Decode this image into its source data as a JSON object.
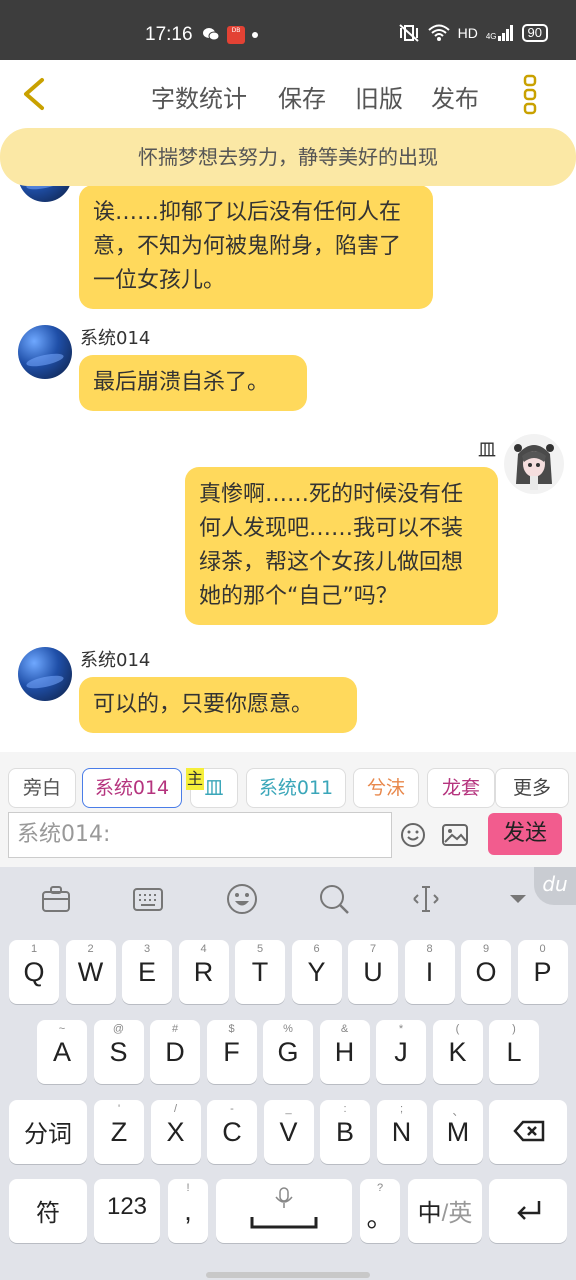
{
  "status_bar": {
    "time": "17:16",
    "app_icon_text": "DB",
    "network": "HD",
    "signal_label": "4G",
    "battery": "90"
  },
  "toolbar": {
    "back_icon": "chevron-left-icon",
    "word_count": "字数统计",
    "save": "保存",
    "old_version": "旧版",
    "publish": "发布",
    "more_icon": "more-vertical-icon"
  },
  "notice": "怀揣梦想去努力，静等美好的出现",
  "messages": [
    {
      "sender": "",
      "side": "left",
      "text": "诶……抑郁了以后没有任何人在意，不知为何被鬼附身，陷害了一位女孩儿。"
    },
    {
      "sender": "系统014",
      "side": "left",
      "text": "最后崩溃自杀了。"
    },
    {
      "sender": "皿",
      "side": "right",
      "text": "真惨啊……死的时候没有任何人发现吧……我可以不装绿茶，帮这个女孩儿做回想她的那个“自己”吗？"
    },
    {
      "sender": "系统014",
      "side": "left",
      "text": "可以的，只要你愿意。"
    }
  ],
  "characters": {
    "narration": "旁白",
    "system014": "系统014",
    "main_mark": "主",
    "main_char": "皿",
    "system011": "系统011",
    "xi_mo": "兮沫",
    "long_tao": "龙套",
    "more": "更多"
  },
  "input": {
    "value": "系统014:"
  },
  "send": "发送",
  "keyboard": {
    "row1": [
      {
        "h": "1",
        "k": "Q"
      },
      {
        "h": "2",
        "k": "W"
      },
      {
        "h": "3",
        "k": "E"
      },
      {
        "h": "4",
        "k": "R"
      },
      {
        "h": "5",
        "k": "T"
      },
      {
        "h": "6",
        "k": "Y"
      },
      {
        "h": "7",
        "k": "U"
      },
      {
        "h": "8",
        "k": "I"
      },
      {
        "h": "9",
        "k": "O"
      },
      {
        "h": "0",
        "k": "P"
      }
    ],
    "row2": [
      {
        "h": "~",
        "k": "A"
      },
      {
        "h": "@",
        "k": "S"
      },
      {
        "h": "#",
        "k": "D"
      },
      {
        "h": "$",
        "k": "F"
      },
      {
        "h": "%",
        "k": "G"
      },
      {
        "h": "&",
        "k": "H"
      },
      {
        "h": "*",
        "k": "J"
      },
      {
        "h": "(",
        "k": "K"
      },
      {
        "h": ")",
        "k": "L"
      }
    ],
    "row3": [
      {
        "h": "'",
        "k": "Z"
      },
      {
        "h": "/",
        "k": "X"
      },
      {
        "h": "-",
        "k": "C"
      },
      {
        "h": "_",
        "k": "V"
      },
      {
        "h": ":",
        "k": "B"
      },
      {
        "h": ";",
        "k": "N"
      },
      {
        "h": "、",
        "k": "M"
      }
    ],
    "fenci": "分词",
    "fu": "符",
    "num": "123",
    "comma_hint": "!",
    "comma": ",",
    "period_hint": "?",
    "period": "。",
    "zh": "中",
    "en": "/英",
    "brand": "du"
  },
  "colors": {
    "bubble": "#ffd95c",
    "notice_bg": "#fbe8a5",
    "send_bg": "#f25c8e",
    "system014": "#b5347e",
    "system011": "#3aa6b9",
    "xi_mo": "#e8874a",
    "long_tao": "#b5347e"
  }
}
